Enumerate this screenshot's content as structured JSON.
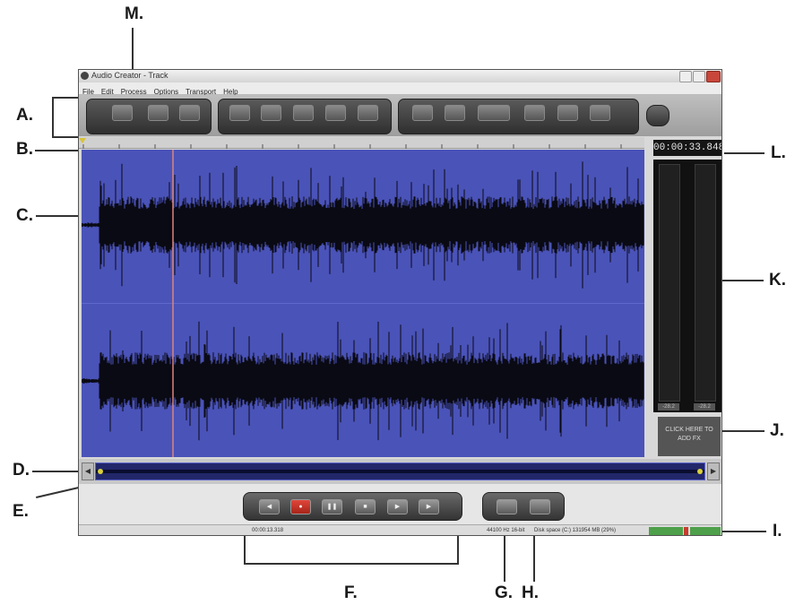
{
  "callouts": {
    "a": "A.",
    "b": "B.",
    "c": "C.",
    "d": "D.",
    "e": "E.",
    "f": "F.",
    "g": "G.",
    "h": "H.",
    "i": "I.",
    "j": "J.",
    "k": "K.",
    "l": "L.",
    "m": "M."
  },
  "app": {
    "title": "Audio Creator - Track"
  },
  "menu": [
    "File",
    "Edit",
    "Process",
    "Options",
    "Transport",
    "Help"
  ],
  "time_display": "00:00:33.848",
  "meters": {
    "left_label": "-28.2",
    "right_label": "-28.2"
  },
  "ad_box": {
    "line1": "CLICK HERE TO",
    "line2": "ADD FX"
  },
  "status": {
    "position": "00:00:13.318",
    "format": "44100 Hz 16-bit",
    "disk": "Disk space (C:) 131954 MB (29%)"
  },
  "icons": {
    "record": "record-icon",
    "stop": "stop-icon",
    "play": "play-icon",
    "pause": "pause-icon"
  }
}
